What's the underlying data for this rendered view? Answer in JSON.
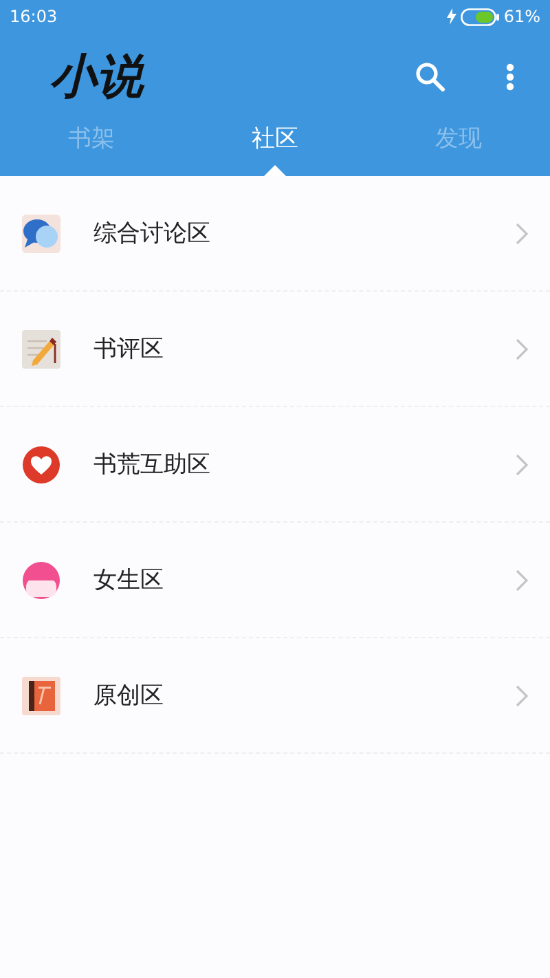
{
  "status_bar": {
    "time": "16:03",
    "battery": "61%"
  },
  "app_bar": {
    "title": "小说"
  },
  "tabs": [
    {
      "label": "书架",
      "selected": false
    },
    {
      "label": "社区",
      "selected": true
    },
    {
      "label": "发现",
      "selected": false
    }
  ],
  "forums": [
    {
      "kind": "chat",
      "label": "综合讨论区"
    },
    {
      "kind": "review",
      "label": "书评区"
    },
    {
      "kind": "heart",
      "label": "书荒互助区"
    },
    {
      "kind": "girl",
      "label": "女生区"
    },
    {
      "kind": "book",
      "label": "原创区"
    }
  ]
}
